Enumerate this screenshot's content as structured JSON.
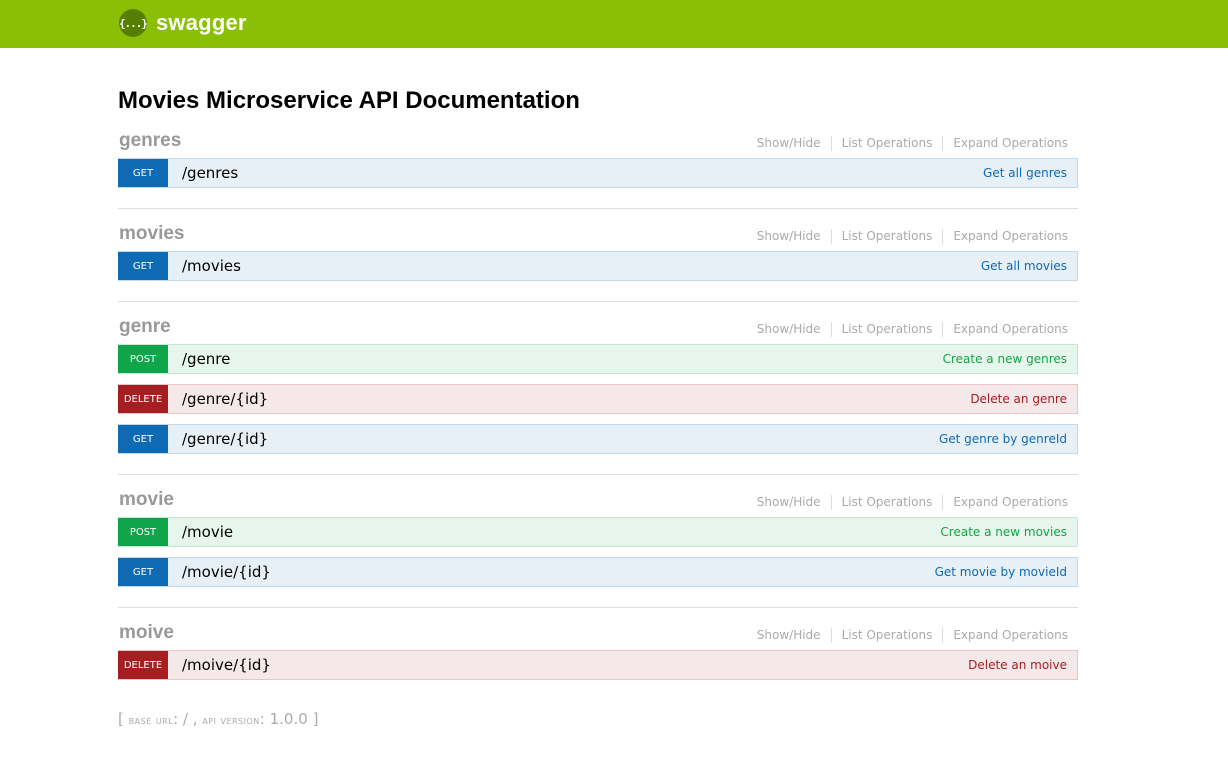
{
  "header": {
    "logo_text": "swagger",
    "logo_icon": "{...}"
  },
  "page": {
    "title": "Movies Microservice API Documentation"
  },
  "options": {
    "show_hide": "Show/Hide",
    "list_ops": "List Operations",
    "expand_ops": "Expand Operations"
  },
  "resources": [
    {
      "name": "genres",
      "ops": [
        {
          "method": "GET",
          "path": "/genres",
          "summary": "Get all genres"
        }
      ]
    },
    {
      "name": "movies",
      "ops": [
        {
          "method": "GET",
          "path": "/movies",
          "summary": "Get all movies"
        }
      ]
    },
    {
      "name": "genre",
      "ops": [
        {
          "method": "POST",
          "path": "/genre",
          "summary": "Create a new genres"
        },
        {
          "method": "DELETE",
          "path": "/genre/{id}",
          "summary": "Delete an genre"
        },
        {
          "method": "GET",
          "path": "/genre/{id}",
          "summary": "Get genre by genreId"
        }
      ]
    },
    {
      "name": "movie",
      "ops": [
        {
          "method": "POST",
          "path": "/movie",
          "summary": "Create a new movies"
        },
        {
          "method": "GET",
          "path": "/movie/{id}",
          "summary": "Get movie by movieId"
        }
      ]
    },
    {
      "name": "moive",
      "ops": [
        {
          "method": "DELETE",
          "path": "/moive/{id}",
          "summary": "Delete an moive"
        }
      ]
    }
  ],
  "footer": {
    "open": "[",
    "base_url_label": "BASE URL",
    "base_url_value": ": / ,",
    "api_version_label": "API VERSION",
    "api_version_value": ": 1.0.0",
    "close": "]"
  },
  "colors": {
    "header": "#89bf04",
    "get": "#0f6ab4",
    "post": "#10a54a",
    "delete": "#a41e22"
  }
}
